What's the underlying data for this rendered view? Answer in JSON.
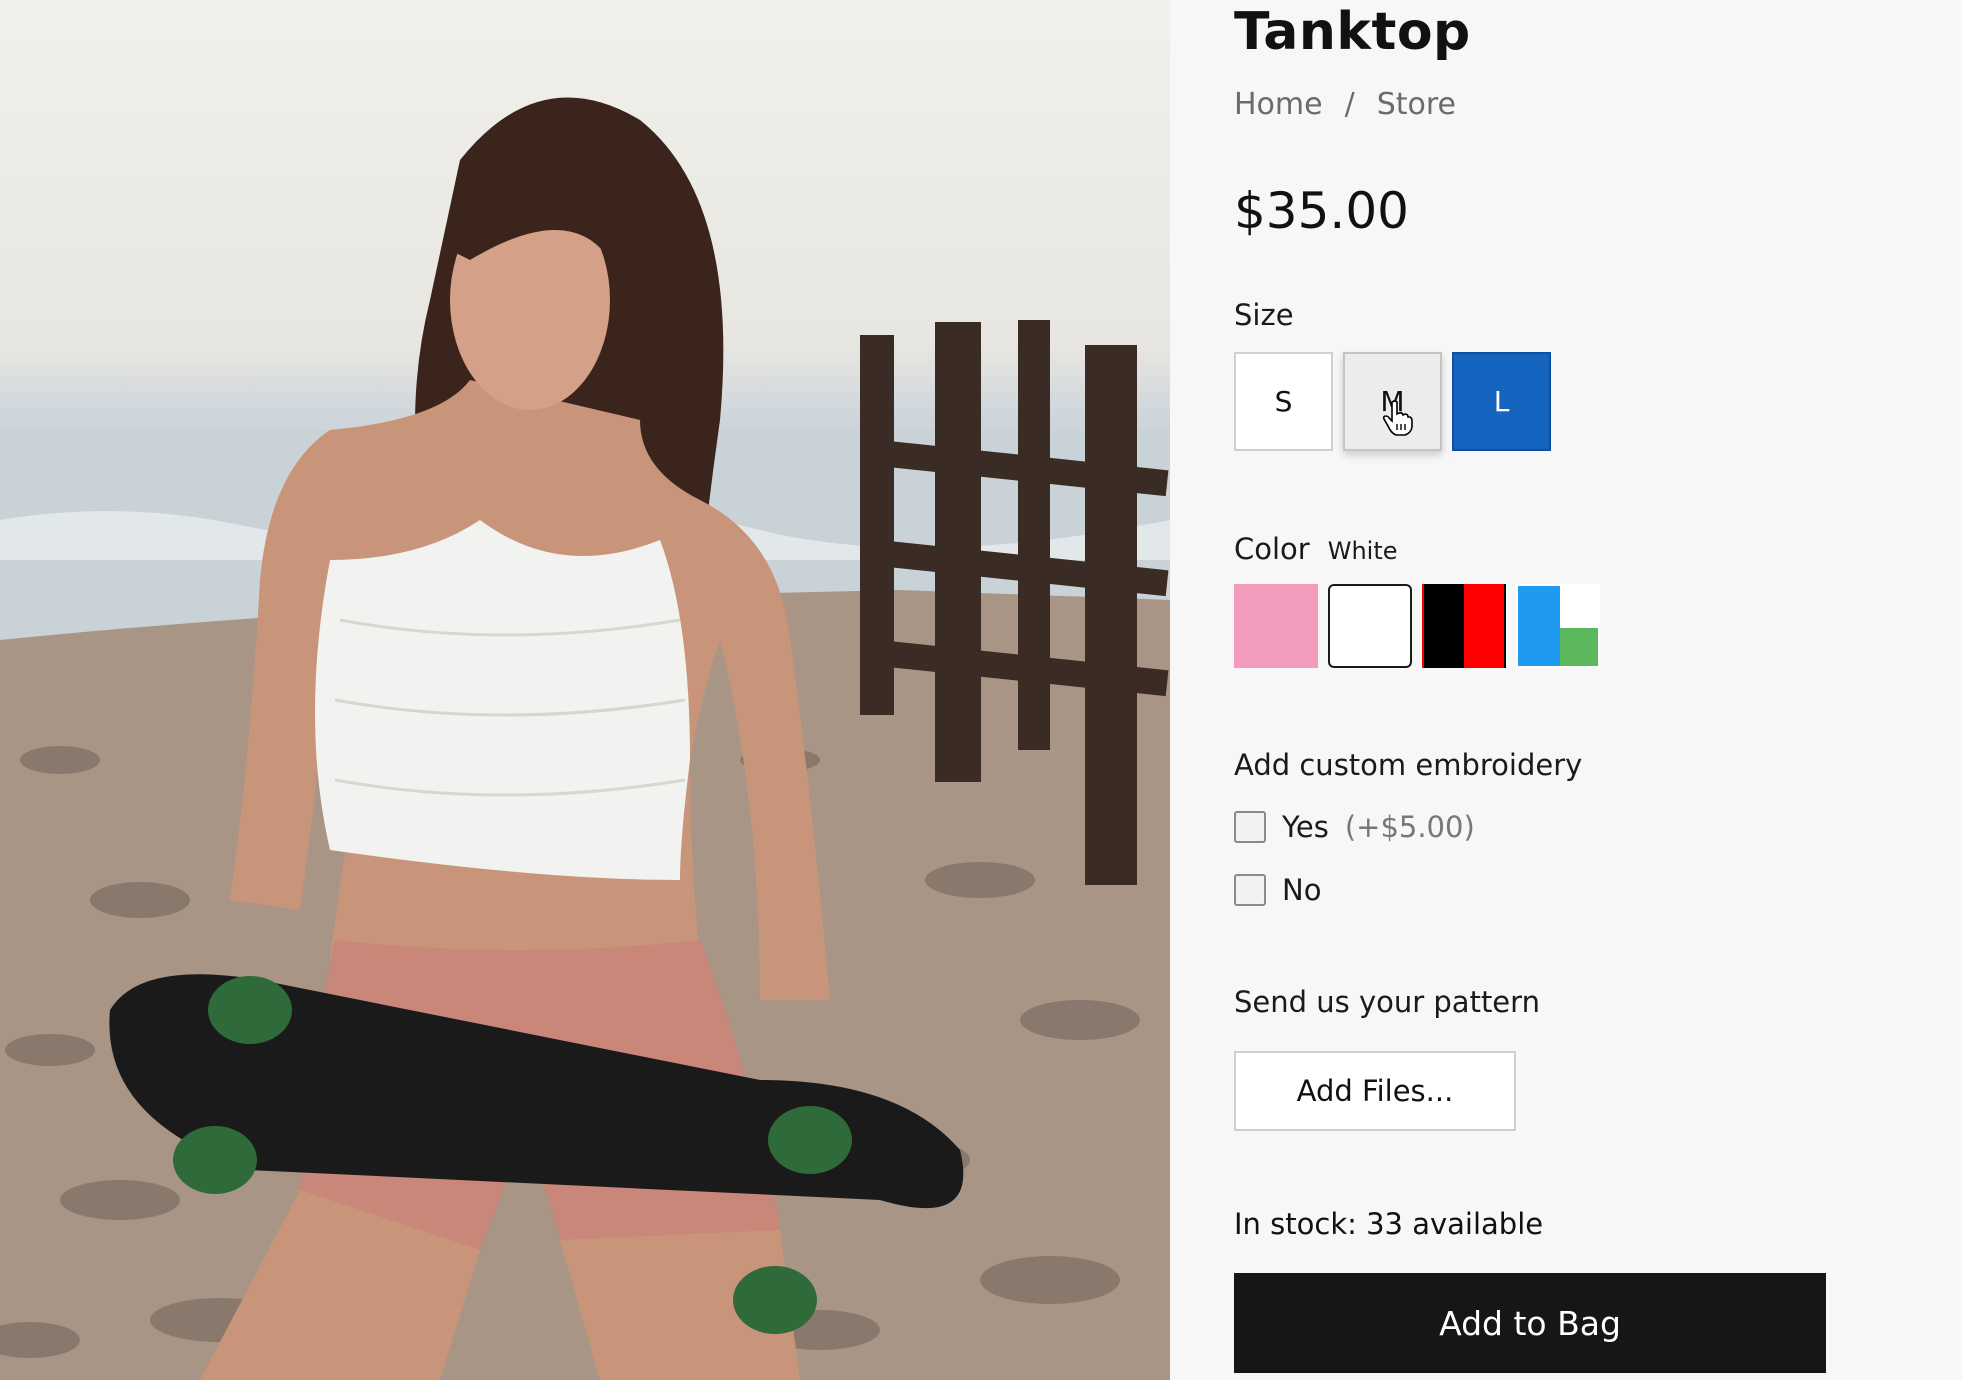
{
  "product": {
    "title": "Tanktop",
    "price": "$35.00",
    "image_alt": "Woman in white crochet tanktop holding a skateboard on a beach"
  },
  "breadcrumb": {
    "home": "Home",
    "separator": "/",
    "store": "Store"
  },
  "size": {
    "label": "Size",
    "options": [
      "S",
      "M",
      "L"
    ],
    "selected": "L",
    "hovered": "M"
  },
  "color": {
    "label": "Color",
    "selected_name": "White",
    "swatches": [
      "pink",
      "white",
      "black-red",
      "blue-white-green"
    ],
    "swatch_colors": {
      "pink": "#f29bbd",
      "white": "#ffffff",
      "black": "#000000",
      "red": "#ff0000",
      "blue": "#1e9bf0",
      "green": "#5cb85c"
    }
  },
  "embroidery": {
    "label": "Add custom embroidery",
    "yes_label": "Yes",
    "yes_extra": "(+$5.00)",
    "no_label": "No"
  },
  "pattern": {
    "label": "Send us your pattern",
    "button_label": "Add Files..."
  },
  "stock": {
    "text": "In stock: 33 available"
  },
  "cart": {
    "button_label": "Add to Bag"
  },
  "theme": {
    "accent": "#1565c0",
    "button_dark": "#161616",
    "background": "#f7f7f7"
  }
}
